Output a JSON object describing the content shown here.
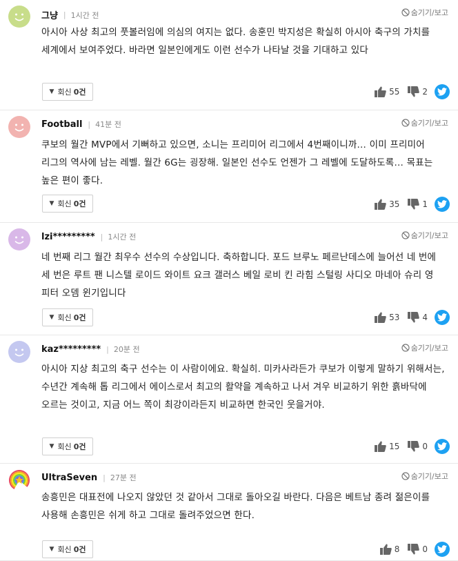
{
  "comments": [
    {
      "author": "그냥",
      "time": "1시간 전",
      "hide_label": "숨기기/보고",
      "avatar_color": "#c8dd8a",
      "avatar_type": "smile",
      "text": "아시아 사상 최고의 풋볼러임에 의심의 여지는 없다. 송훈민 박지성은 확실히 아시아 축구의 가치를 세계에서 보여주었다. 바라면 일본인에게도 이런 선수가 나타날 것을 기대하고 있다",
      "reply_label": "회신",
      "reply_count": "0건",
      "likes": "55",
      "dislikes": "2"
    },
    {
      "author": "Football",
      "time": "41분 전",
      "hide_label": "숨기기/보고",
      "avatar_color": "#f2b3b0",
      "avatar_type": "smile",
      "text": "쿠보의 월간 MVP에서 기뻐하고 있으면, 소니는 프리미어 리그에서 4번째이니까… 이미 프리미어 리그의 역사에 남는 레벨. 월간 6G는 굉장해. 일본인 선수도 언젠가 그 레벨에 도달하도록… 목표는 높은 편이 좋다.",
      "reply_label": "회신",
      "reply_count": "0건",
      "likes": "35",
      "dislikes": "1"
    },
    {
      "author": "lzi*********",
      "time": "1시간 전",
      "hide_label": "숨기기/보고",
      "avatar_color": "#d9b8e8",
      "avatar_type": "smile",
      "text": "네 번째 리그 월간 최우수 선수의 수상입니다. 축하합니다. 포드 브루노 페르난데스에 늘어선 네 번에 세 번은 루트 팬 니스텔 로이드 와이트 요크 갤러스 베일 로비 킨 라힘 스털링 사디오 마네아 슈리 영 피터 오뎀 윈기입니다",
      "reply_label": "회신",
      "reply_count": "0건",
      "likes": "53",
      "dislikes": "4"
    },
    {
      "author": "kaz*********",
      "time": "20분 전",
      "hide_label": "숨기기/보고",
      "avatar_color": "#c4c8f0",
      "avatar_type": "smile",
      "text": "아시아 지상 최고의 축구 선수는 이 사람이에요. 확실히. 미카사라든가 쿠보가 이렇게 말하기 위해서는, 수년간 계속해 톱 리그에서 에이스로서 최고의 활약을 계속하고 나서 겨우 비교하기 위한 흙바닥에 오르는 것이고, 지금 어느 쪽이 최강이라든지 비교하면 한국인 웃을거야.",
      "reply_label": "회신",
      "reply_count": "0건",
      "likes": "15",
      "dislikes": "0"
    },
    {
      "author": "UltraSeven",
      "time": "27분 전",
      "hide_label": "숨기기/보고",
      "avatar_color": "#ffffff",
      "avatar_type": "rainbow",
      "text": "송흥민은 대표전에 나오지 않았던 것 같아서 그대로 돌아오길 바란다. 다음은 베트남 종려 젊은이를 사용해 손흥민은 쉬게 하고 그대로 돌려주었으면 한다.",
      "reply_label": "회신",
      "reply_count": "0건",
      "likes": "8",
      "dislikes": "0"
    }
  ],
  "colors": {
    "twitter": "#1da1f2",
    "thumb": "#666666"
  }
}
